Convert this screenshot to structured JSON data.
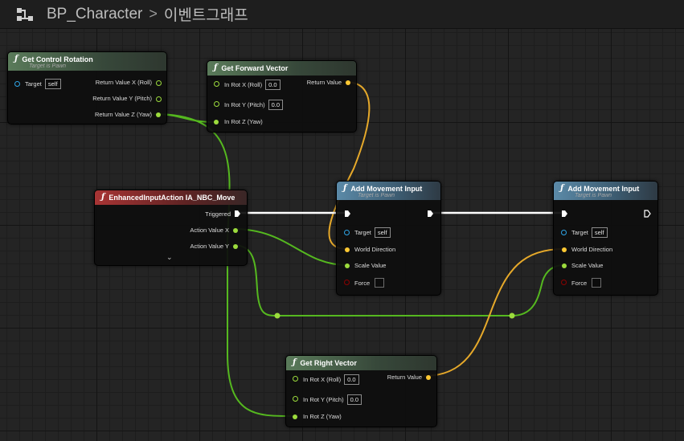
{
  "titlebar": {
    "blueprint": "BP_Character",
    "separator": ">",
    "graph": "이벤트그래프"
  },
  "nodes": {
    "get_control_rotation": {
      "title": "Get Control Rotation",
      "subtitle": "Target is Pawn",
      "target_label": "Target",
      "target_value": "self",
      "out_x": "Return Value X (Roll)",
      "out_y": "Return Value Y (Pitch)",
      "out_z": "Return Value Z (Yaw)"
    },
    "get_forward_vector": {
      "title": "Get Forward Vector",
      "in_x": "In Rot X (Roll)",
      "in_x_value": "0.0",
      "in_y": "In Rot Y (Pitch)",
      "in_y_value": "0.0",
      "in_z": "In Rot Z (Yaw)",
      "out": "Return Value"
    },
    "enhanced_input": {
      "title": "EnhancedInputAction IA_NBC_Move",
      "triggered": "Triggered",
      "action_x": "Action Value X",
      "action_y": "Action Value Y"
    },
    "add_movement_1": {
      "title": "Add Movement Input",
      "subtitle": "Target is Pawn",
      "target_label": "Target",
      "target_value": "self",
      "world_direction": "World Direction",
      "scale_value": "Scale Value",
      "force": "Force"
    },
    "add_movement_2": {
      "title": "Add Movement Input",
      "subtitle": "Target is Pawn",
      "target_label": "Target",
      "target_value": "self",
      "world_direction": "World Direction",
      "scale_value": "Scale Value",
      "force": "Force"
    },
    "get_right_vector": {
      "title": "Get Right Vector",
      "in_x": "In Rot X (Roll)",
      "in_x_value": "0.0",
      "in_y": "In Rot Y (Pitch)",
      "in_y_value": "0.0",
      "in_z": "In Rot Z (Yaw)",
      "out": "Return Value"
    }
  },
  "colors": {
    "float_pin": "#9cdb3d",
    "float_wire": "#55b81f",
    "vector_pin": "#fdc833",
    "vector_wire": "#e6a92a",
    "object_pin": "#2fa5e6",
    "bool_pin": "#8c0000",
    "exec": "#ffffff",
    "function_header": "#5a7b5a",
    "pawn_function_header": "#5b8aa8",
    "event_header": "#a83434"
  },
  "icons": {
    "graph": "event-graph-icon",
    "function": "function-f-icon",
    "expand": "chevron-down-icon"
  }
}
